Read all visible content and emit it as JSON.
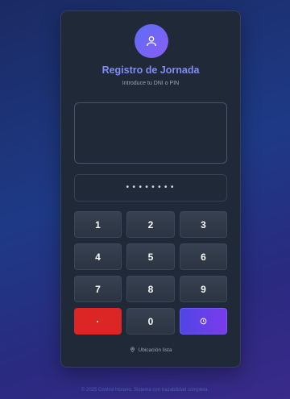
{
  "header": {
    "title": "Registro de Jornada",
    "subtitle": "Introduce tu DNI o PIN",
    "avatar_icon": "user-icon"
  },
  "input": {
    "pin_masked": "••••••••"
  },
  "keypad": {
    "keys": [
      "1",
      "2",
      "3",
      "4",
      "5",
      "6",
      "7",
      "8",
      "9"
    ],
    "clear_label": "·",
    "zero_label": "0",
    "submit_icon": "clock-icon"
  },
  "status": {
    "text": "Ubicación lista",
    "icon": "location-pin-icon"
  },
  "footer": {
    "text": "© 2025 Control Horario. Sistema con trazabilidad completa."
  },
  "colors": {
    "accent": "#818cf8",
    "clear": "#dc2626",
    "submit_gradient": [
      "#4f46e5",
      "#7c3aed"
    ]
  }
}
